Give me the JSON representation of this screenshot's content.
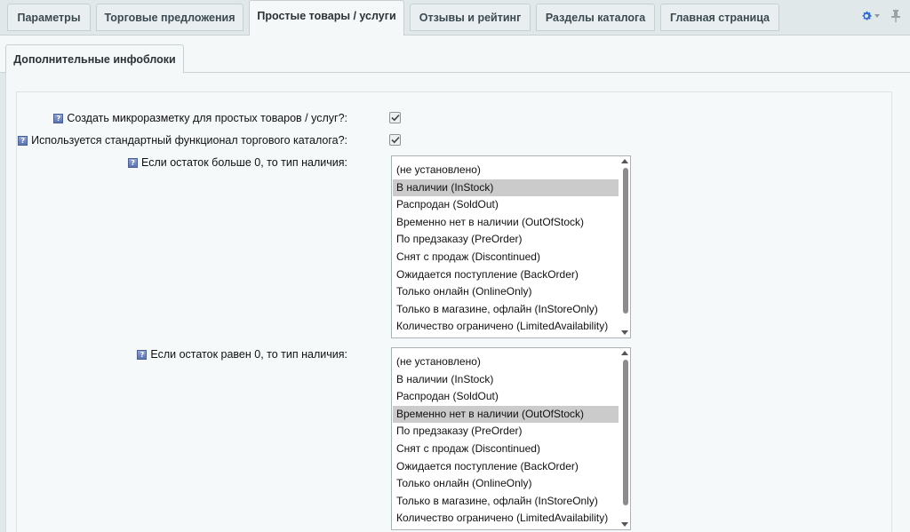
{
  "tabs": [
    {
      "label": "Параметры",
      "name": "tab-parameters"
    },
    {
      "label": "Торговые предложения",
      "name": "tab-trade-offers"
    },
    {
      "label": "Простые товары / услуги",
      "name": "tab-simple-products",
      "active": true
    },
    {
      "label": "Отзывы и рейтинг",
      "name": "tab-reviews"
    },
    {
      "label": "Разделы каталога",
      "name": "tab-catalog-sections"
    },
    {
      "label": "Главная страница",
      "name": "tab-main-page"
    }
  ],
  "subtab": {
    "label": "Дополнительные инфоблоки"
  },
  "help_glyph": "?",
  "fields": {
    "microdata": {
      "label": "Создать микроразметку для простых товаров / услуг?:",
      "checked": true
    },
    "standard_catalog": {
      "label": "Используется стандартный функционал торгового каталога?:",
      "checked": true
    },
    "stock_positive": {
      "label": "Если остаток больше 0, то тип наличия:",
      "selected": 1
    },
    "stock_zero": {
      "label": "Если остаток равен 0, то тип наличия:",
      "selected": 3
    }
  },
  "availability_options": [
    "(не установлено)",
    "В наличии (InStock)",
    "Распродан (SoldOut)",
    "Временно нет в наличии (OutOfStock)",
    "По предзаказу (PreOrder)",
    "Снят с продаж (Discontinued)",
    "Ожидается поступление (BackOrder)",
    "Только онлайн (OnlineOnly)",
    "Только в магазине, офлайн (InStoreOnly)",
    "Количество ограничено (LimitedAvailability)"
  ],
  "icons": {
    "settings": "gear-icon",
    "pin": "pin-icon",
    "help": "help-icon",
    "check": "checkmark-icon"
  },
  "colors": {
    "accent": "#2f6bd0",
    "selected_option": "#cbcbcb",
    "background": "#e1e8ea"
  }
}
